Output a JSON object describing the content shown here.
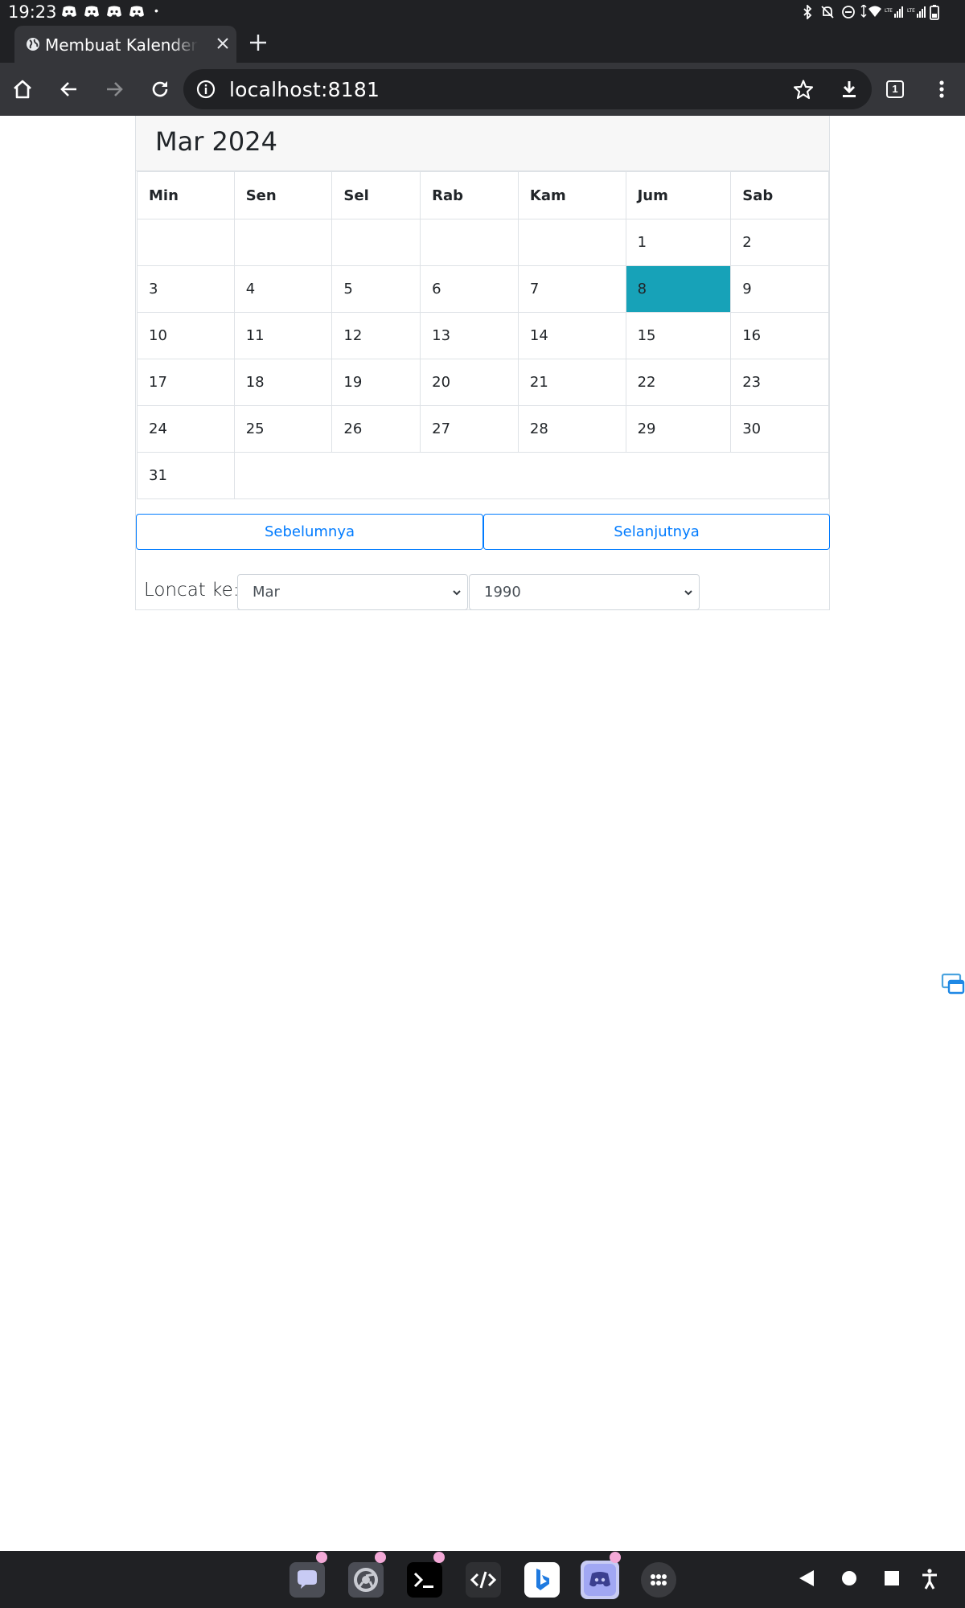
{
  "status_bar": {
    "time": "19:23",
    "notification_icons": [
      "discord-icon",
      "discord-icon",
      "discord-icon",
      "discord-icon"
    ],
    "system_icons": [
      "bluetooth-icon",
      "notifications-off-icon",
      "do-not-disturb-icon",
      "wifi-icon",
      "signal-lte-icon",
      "signal-lte-icon",
      "battery-icon"
    ]
  },
  "browser": {
    "tab_title": "Membuat Kalender dengan",
    "url": "localhost:8181",
    "tab_count": "1"
  },
  "calendar": {
    "title": "Mar 2024",
    "weekdays": [
      "Min",
      "Sen",
      "Sel",
      "Rab",
      "Kam",
      "Jum",
      "Sab"
    ],
    "weeks": [
      [
        "",
        "",
        "",
        "",
        "",
        "1",
        "2"
      ],
      [
        "3",
        "4",
        "5",
        "6",
        "7",
        "8",
        "9"
      ],
      [
        "10",
        "11",
        "12",
        "13",
        "14",
        "15",
        "16"
      ],
      [
        "17",
        "18",
        "19",
        "20",
        "21",
        "22",
        "23"
      ],
      [
        "24",
        "25",
        "26",
        "27",
        "28",
        "29",
        "30"
      ],
      [
        "31"
      ]
    ],
    "today": "8",
    "today_color": "#17a2b8",
    "previous_label": "Sebelumnya",
    "next_label": "Selanjutnya",
    "jump_label": "Loncat ke:",
    "jump_month": "Mar",
    "jump_year": "1990",
    "accent_color": "#007bff"
  },
  "taskbar": {
    "apps": [
      "chat-app-icon",
      "chrome-icon",
      "terminal-icon",
      "code-editor-icon",
      "bing-icon",
      "discord-icon",
      "app-drawer-icon"
    ],
    "nav": [
      "back-icon",
      "home-icon",
      "recents-icon",
      "accessibility-icon"
    ]
  }
}
